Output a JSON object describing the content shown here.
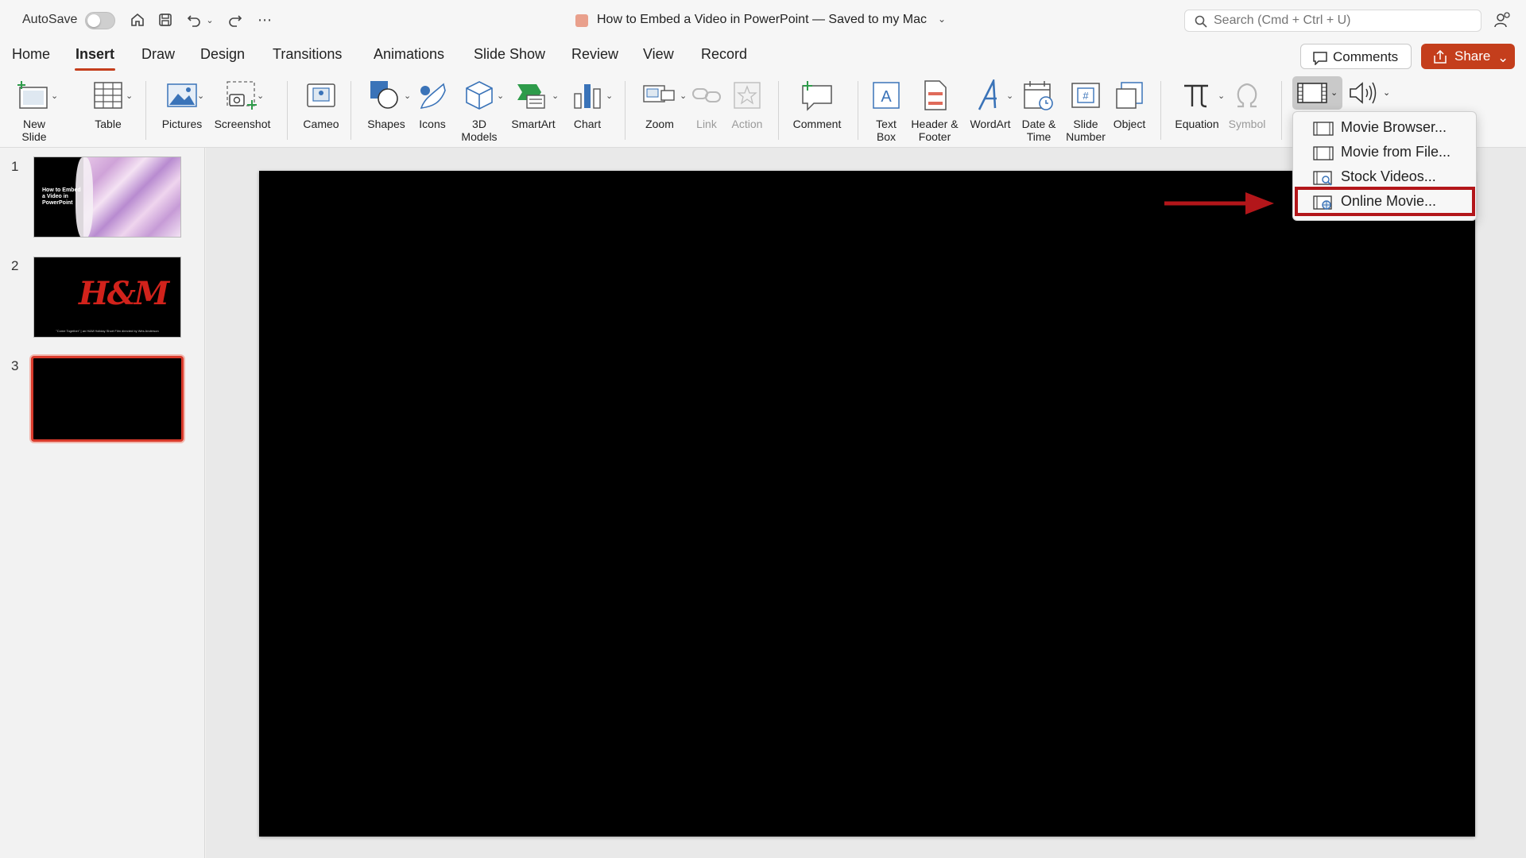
{
  "window": {
    "autosave_label": "AutoSave",
    "doc_title": "How to Embed a Video in PowerPoint — Saved to my Mac",
    "search_placeholder": "Search (Cmd + Ctrl + U)"
  },
  "tabs": [
    "Home",
    "Insert",
    "Draw",
    "Design",
    "Transitions",
    "Animations",
    "Slide Show",
    "Review",
    "View",
    "Record"
  ],
  "active_tab": "Insert",
  "header_buttons": {
    "comments": "Comments",
    "share": "Share"
  },
  "ribbon": {
    "new_slide": "New\nSlide",
    "table": "Table",
    "pictures": "Pictures",
    "screenshot": "Screenshot",
    "cameo": "Cameo",
    "shapes": "Shapes",
    "icons": "Icons",
    "models_3d": "3D\nModels",
    "smartart": "SmartArt",
    "chart": "Chart",
    "zoom": "Zoom",
    "link": "Link",
    "action": "Action",
    "comment": "Comment",
    "text_box": "Text\nBox",
    "header_footer": "Header &\nFooter",
    "wordart": "WordArt",
    "date_time": "Date &\nTime",
    "slide_number": "Slide\nNumber",
    "object": "Object",
    "equation": "Equation",
    "symbol": "Symbol"
  },
  "video_menu": {
    "items": [
      "Movie Browser...",
      "Movie from File...",
      "Stock Videos...",
      "Online Movie..."
    ],
    "highlighted": "Online Movie..."
  },
  "slides": [
    {
      "number": "1",
      "title_text": "How to Embed a Video in PowerPoint"
    },
    {
      "number": "2",
      "logo_text": "H&M",
      "caption": "\"Come Together\" | an H&M Holiday Short Film directed by Wes Anderson"
    },
    {
      "number": "3"
    }
  ],
  "colors": {
    "accent": "#c43e1c",
    "highlight": "#b3161a",
    "selected_thumb": "#d93a2b"
  }
}
